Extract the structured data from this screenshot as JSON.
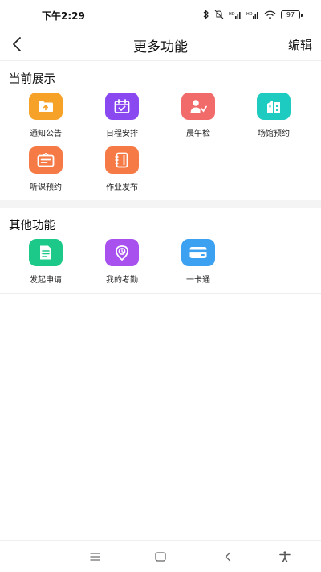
{
  "status_bar": {
    "time": "下午2:29",
    "battery": "97",
    "icons": [
      "bluetooth-icon",
      "mute-icon",
      "signal-icon",
      "signal-icon",
      "wifi-icon",
      "battery-icon"
    ]
  },
  "nav": {
    "back_icon": "chevron-left-icon",
    "title": "更多功能",
    "edit_label": "编辑"
  },
  "current_section": {
    "title": "当前展示",
    "items": [
      {
        "label": "通知公告",
        "color": "#F6A128",
        "icon": "upload-folder-icon"
      },
      {
        "label": "日程安排",
        "color": "#8A48F0",
        "icon": "calendar-check-icon"
      },
      {
        "label": "晨午检",
        "color": "#F26B6B",
        "icon": "person-check-icon"
      },
      {
        "label": "场馆预约",
        "color": "#1ECBC0",
        "icon": "building-icon"
      },
      {
        "label": "听课预约",
        "color": "#F57A45",
        "icon": "easel-icon"
      },
      {
        "label": "作业发布",
        "color": "#F57A45",
        "icon": "notebook-icon"
      }
    ]
  },
  "other_section": {
    "title": "其他功能",
    "items": [
      {
        "label": "发起申请",
        "color": "#1CC988",
        "icon": "document-icon"
      },
      {
        "label": "我的考勤",
        "color": "#A851EE",
        "icon": "location-clock-icon"
      },
      {
        "label": "一卡通",
        "color": "#3DA1F2",
        "icon": "card-icon"
      }
    ]
  },
  "bottom_nav": {
    "icons": [
      "menu-icon",
      "home-icon",
      "back-icon",
      "accessibility-icon"
    ]
  }
}
